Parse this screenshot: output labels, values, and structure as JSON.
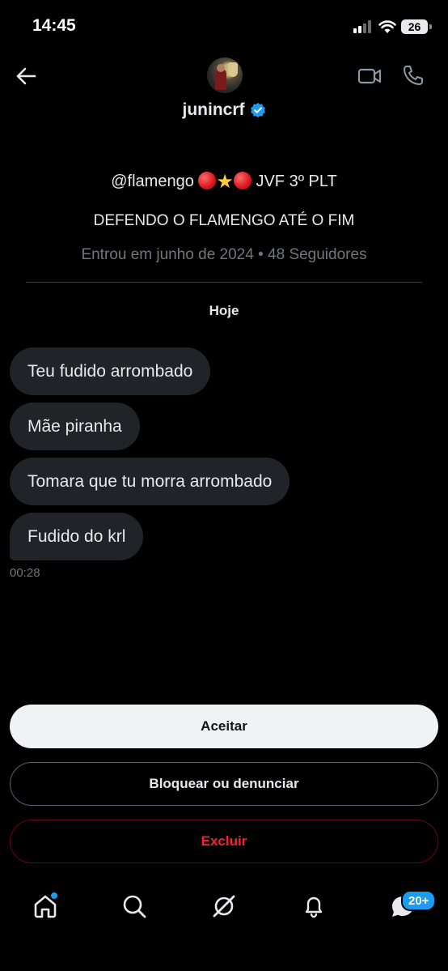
{
  "status_bar": {
    "time": "14:45",
    "battery": "26"
  },
  "header": {
    "back_icon": "arrow-left-icon",
    "username": "junincrf",
    "verified_icon": "verified-badge-icon",
    "video_icon": "video-camera-icon",
    "phone_icon": "phone-icon"
  },
  "profile": {
    "bio_handle": "@flamengo",
    "bio_emojis": [
      "red-circle",
      "star",
      "red-circle"
    ],
    "bio_suffix": "JVF 3º PLT",
    "bio_line2": "DEFENDO O FLAMENGO ATÉ O FIM",
    "meta": "Entrou em junho de 2024 • 48 Seguidores"
  },
  "conversation": {
    "day_label": "Hoje",
    "messages": [
      {
        "text": "Teu fudido arrombado"
      },
      {
        "text": "Mãe piranha"
      },
      {
        "text": "Tomara que tu morra arrombado"
      },
      {
        "text": "Fudido do krl"
      }
    ],
    "last_time": "00:28"
  },
  "actions": {
    "accept": "Aceitar",
    "block_report": "Bloquear ou denunciar",
    "delete": "Excluir"
  },
  "bottom_nav": {
    "items": [
      "home-icon",
      "search-icon",
      "grok-icon",
      "notifications-bell-icon",
      "messages-icon"
    ],
    "messages_badge": "20+"
  },
  "colors": {
    "background": "#000000",
    "bubble": "#202327",
    "accent_blue": "#1d9bf0",
    "danger_red": "#f4212e",
    "muted_text": "#71767b"
  }
}
